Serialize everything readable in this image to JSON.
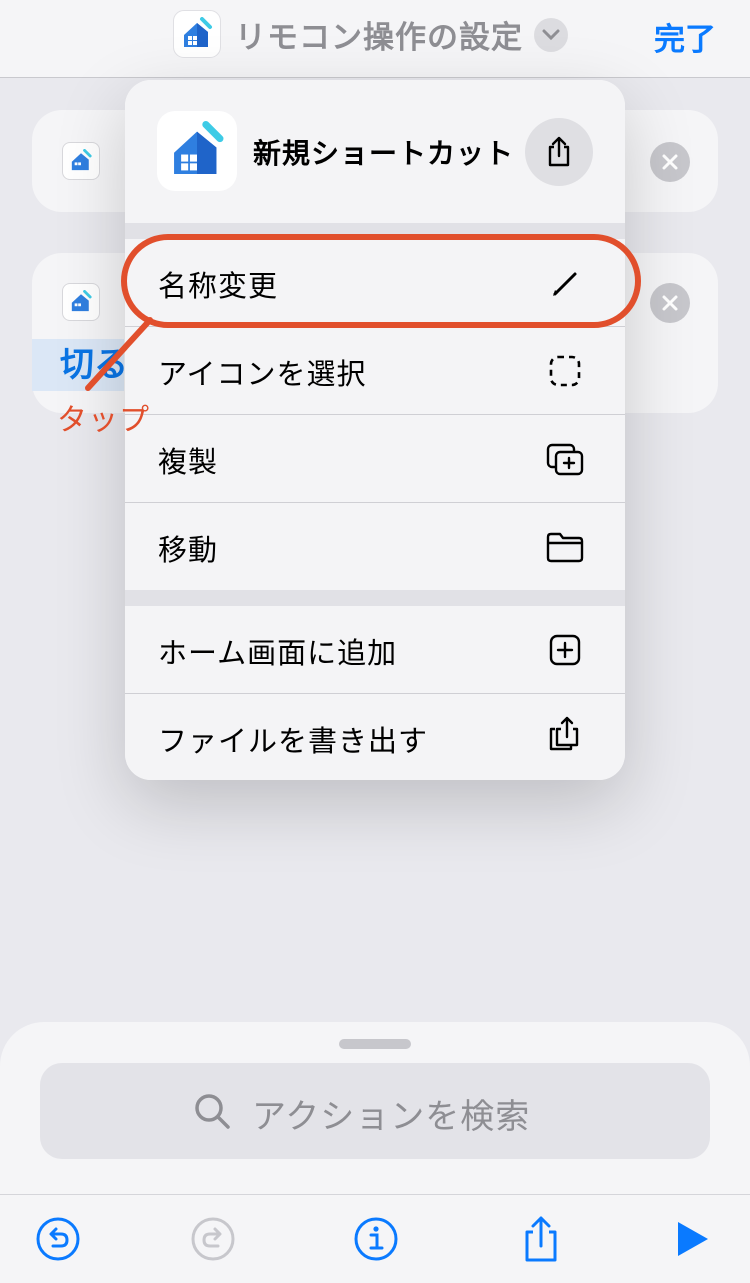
{
  "nav": {
    "title": "リモコン操作の設定",
    "done_label": "完了"
  },
  "background": {
    "variable_pill": "切る"
  },
  "menu": {
    "app_name": "新規ショートカット",
    "items": [
      {
        "label": "名称変更",
        "icon": "pencil-icon"
      },
      {
        "label": "アイコンを選択",
        "icon": "dashed-square-icon"
      },
      {
        "label": "複製",
        "icon": "duplicate-icon"
      },
      {
        "label": "移動",
        "icon": "folder-icon"
      },
      {
        "label": "ホーム画面に追加",
        "icon": "plus-square-icon"
      },
      {
        "label": "ファイルを書き出す",
        "icon": "export-icon"
      }
    ]
  },
  "annotation": {
    "tap_label": "タップ",
    "color": "#e14f2c"
  },
  "search": {
    "placeholder": "アクションを検索"
  },
  "toolbar": {
    "items": [
      "undo-icon",
      "redo-icon",
      "info-icon",
      "share-icon",
      "play-icon"
    ]
  },
  "colors": {
    "accent": "#0a7aff",
    "annotation": "#e14f2c"
  }
}
